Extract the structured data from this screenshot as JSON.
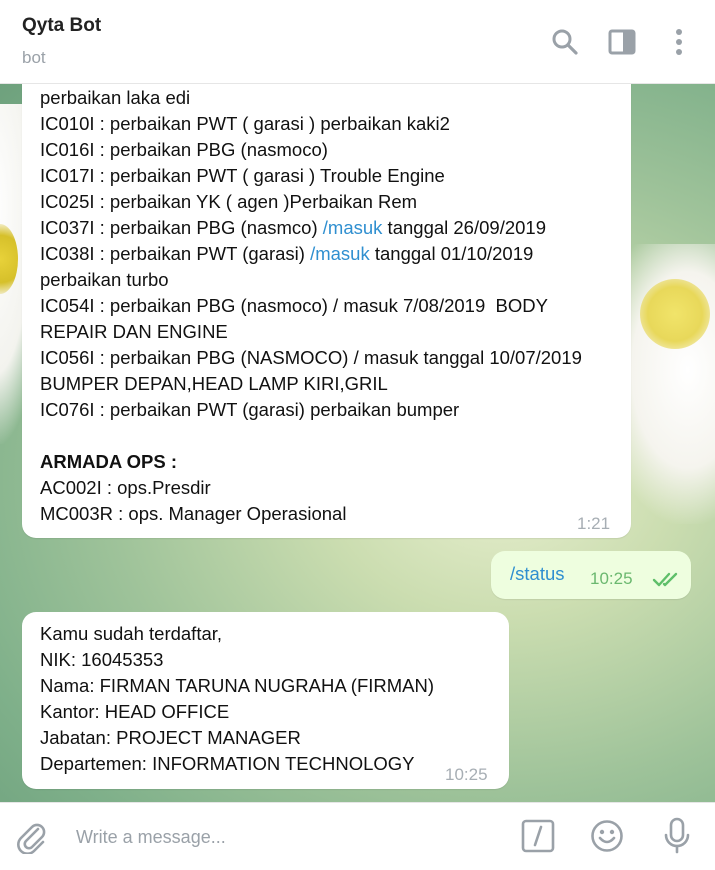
{
  "header": {
    "title": "Qyta Bot",
    "subtitle": "bot"
  },
  "message_1": {
    "lines": [
      {
        "text": "perbaikan laka edi"
      },
      {
        "text": "IC010I : perbaikan PWT ( garasi ) perbaikan kaki2"
      },
      {
        "text": "IC016I : perbaikan PBG (nasmoco)"
      },
      {
        "text": "IC017I : perbaikan PWT ( garasi ) Trouble Engine"
      },
      {
        "text": "IC025I : perbaikan YK ( agen )Perbaikan Rem"
      },
      {
        "pre": "IC037I : perbaikan PBG (nasmco) ",
        "link": "/masuk",
        "post": " tanggal 26/09/2019"
      },
      {
        "pre": "IC038I : perbaikan PWT (garasi) ",
        "link": "/masuk",
        "post": " tanggal 01/10/2019"
      },
      {
        "text": "perbaikan turbo"
      },
      {
        "text": "IC054I : perbaikan PBG (nasmoco) / masuk 7/08/2019  BODY"
      },
      {
        "text": "REPAIR DAN ENGINE"
      },
      {
        "text": "IC056I : perbaikan PBG (NASMOCO) / masuk tanggal 10/07/2019"
      },
      {
        "text": "BUMPER DEPAN,HEAD LAMP KIRI,GRIL"
      },
      {
        "text": "IC076I : perbaikan PWT (garasi) perbaikan bumper"
      },
      {
        "text": ""
      },
      {
        "text": "ARMADA OPS :",
        "bold": true
      },
      {
        "text": "AC002I : ops.Presdir"
      },
      {
        "text": "MC003R : ops. Manager Operasional"
      }
    ],
    "time": "1:21"
  },
  "message_2": {
    "text": "/status",
    "time": "10:25",
    "status_icon": "double-check-icon"
  },
  "message_3": {
    "lines": [
      "Kamu sudah terdaftar,",
      "NIK: 16045353",
      "Nama: FIRMAN TARUNA NUGRAHA (FIRMAN)",
      "Kantor: HEAD OFFICE",
      "Jabatan: PROJECT MANAGER",
      "Departemen: INFORMATION TECHNOLOGY"
    ],
    "time": "10:25"
  },
  "input": {
    "placeholder": "Write a message..."
  },
  "icons": {
    "header": [
      "search-icon",
      "sidebar-toggle-icon",
      "more-vertical-icon"
    ],
    "input": [
      "attach-icon",
      "bot-command-icon",
      "emoji-icon",
      "microphone-icon"
    ]
  },
  "colors": {
    "link": "#2f8fd0",
    "outgoing_bubble": "#eefedf",
    "read_check": "#5fbf6a",
    "timestamp": "#a7aeb4",
    "icon": "#9aa1a8"
  }
}
